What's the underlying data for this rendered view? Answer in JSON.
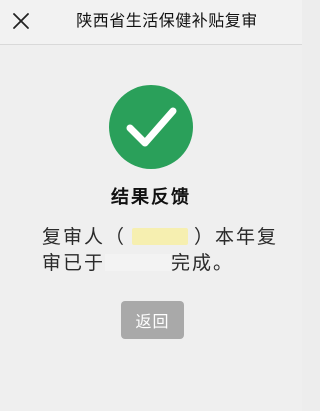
{
  "nav": {
    "title": "陕西省生活保健补贴复审",
    "close_icon": "close-icon"
  },
  "result": {
    "icon": "check-circle-icon",
    "icon_color": "#2aa05a",
    "title": "结果反馈",
    "line1_part1": "复审人（",
    "line1_part2": "）本年复",
    "line2_part1": "审已于",
    "line2_part2": "完成。"
  },
  "actions": {
    "back_label": "返回",
    "back_color": "#a9a9a9"
  }
}
